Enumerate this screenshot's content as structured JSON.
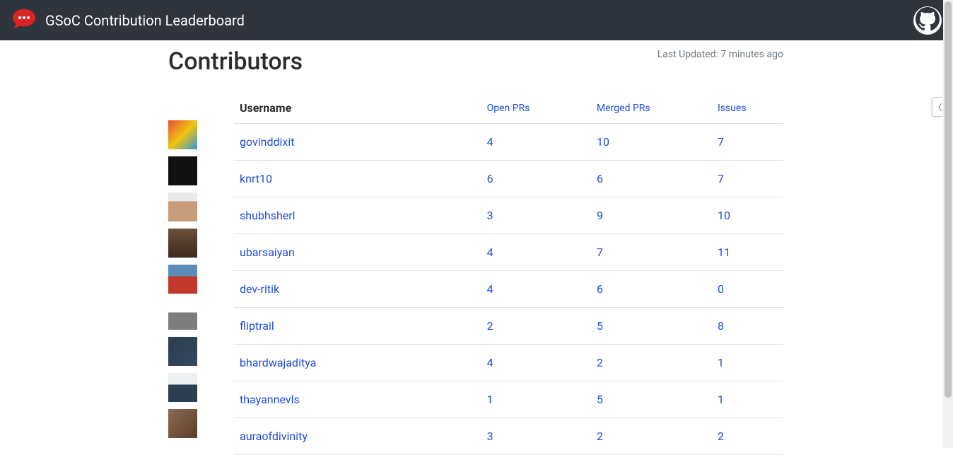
{
  "header": {
    "title": "GSoC Contribution Leaderboard",
    "logo_icon": "chat-bubble-icon",
    "github_icon": "github-icon"
  },
  "page": {
    "title": "Contributors",
    "last_updated": "Last Updated: 7 minutes ago"
  },
  "table": {
    "columns": {
      "username": "Username",
      "open_prs": "Open PRs",
      "merged_prs": "Merged PRs",
      "issues": "Issues"
    },
    "rows": [
      {
        "username": "govinddixit",
        "open_prs": "4",
        "merged_prs": "10",
        "issues": "7"
      },
      {
        "username": "knrt10",
        "open_prs": "6",
        "merged_prs": "6",
        "issues": "7"
      },
      {
        "username": "shubhsherl",
        "open_prs": "3",
        "merged_prs": "9",
        "issues": "10"
      },
      {
        "username": "ubarsaiyan",
        "open_prs": "4",
        "merged_prs": "7",
        "issues": "11"
      },
      {
        "username": "dev-ritik",
        "open_prs": "4",
        "merged_prs": "6",
        "issues": "0"
      },
      {
        "username": "fliptrail",
        "open_prs": "2",
        "merged_prs": "5",
        "issues": "8"
      },
      {
        "username": "bhardwajaditya",
        "open_prs": "4",
        "merged_prs": "2",
        "issues": "1"
      },
      {
        "username": "thayannevls",
        "open_prs": "1",
        "merged_prs": "5",
        "issues": "1"
      },
      {
        "username": "auraofdivinity",
        "open_prs": "3",
        "merged_prs": "2",
        "issues": "2"
      }
    ]
  },
  "colors": {
    "header_bg": "#2f343d",
    "link": "#1d4ed8",
    "muted": "#6c757d",
    "border": "#dee2e6"
  }
}
